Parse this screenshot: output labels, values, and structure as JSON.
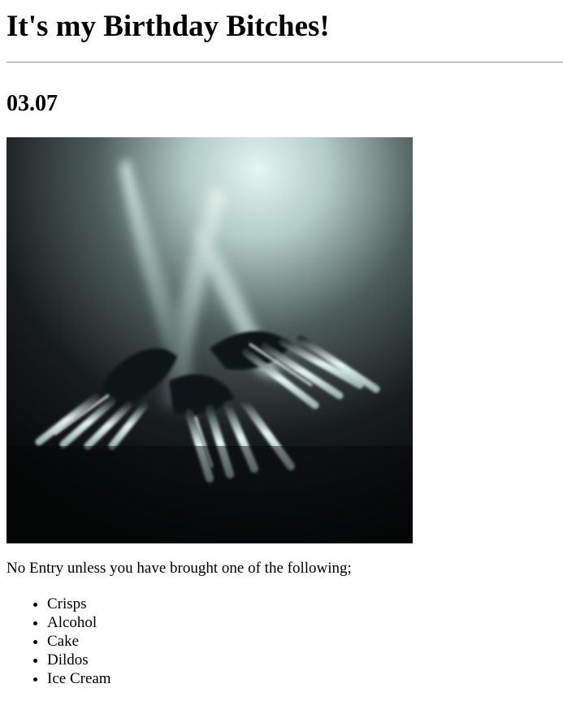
{
  "heading": "It's my Birthday Bitches!",
  "date": "03.07",
  "photo": {
    "subject": "forks"
  },
  "intro": "No Entry unless you have brought one of the following;",
  "items": [
    "Crisps",
    "Alcohol",
    "Cake",
    "Dildos",
    "Ice Cream"
  ]
}
